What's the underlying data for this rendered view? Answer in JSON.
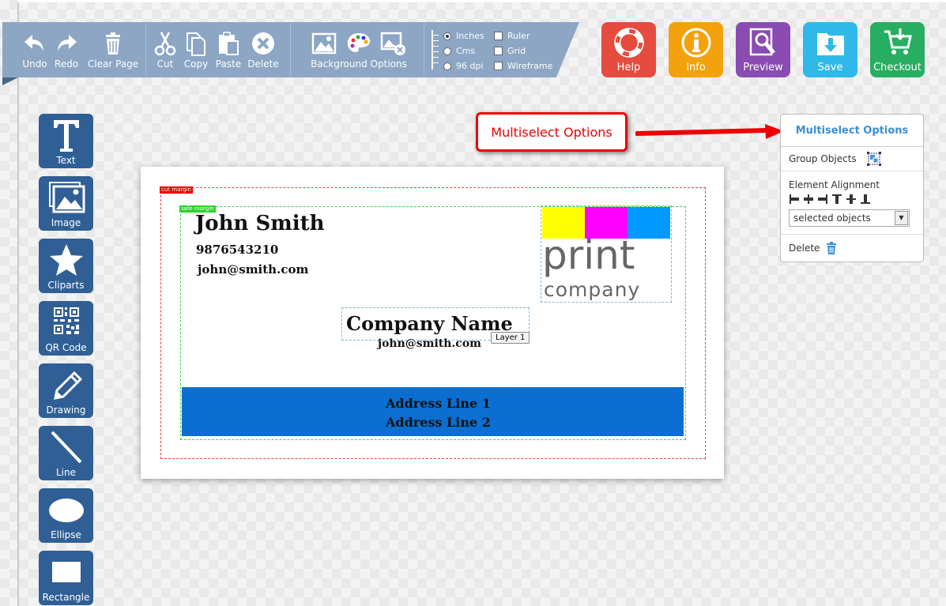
{
  "toolbar": {
    "undo": "Undo",
    "redo": "Redo",
    "clear_page": "Clear Page",
    "cut": "Cut",
    "copy": "Copy",
    "paste": "Paste",
    "delete": "Delete",
    "background_options": "Background Options",
    "units": [
      {
        "label": "Inches",
        "selected": true
      },
      {
        "label": "Cms",
        "selected": false
      },
      {
        "label": "96 dpi",
        "selected": false
      }
    ],
    "toggles": [
      {
        "label": "Ruler",
        "checked": false
      },
      {
        "label": "Grid",
        "checked": false
      },
      {
        "label": "Wireframe",
        "checked": false
      }
    ]
  },
  "actions": {
    "help": {
      "label": "Help",
      "color": "#e54b3e"
    },
    "info": {
      "label": "Info",
      "color": "#f4a20c"
    },
    "preview": {
      "label": "Preview",
      "color": "#8a4bb2"
    },
    "save": {
      "label": "Save",
      "color": "#2fb9e8"
    },
    "checkout": {
      "label": "Checkout",
      "color": "#27ae60"
    }
  },
  "tools": {
    "text": "Text",
    "image": "Image",
    "cliparts": "Cliparts",
    "qr_code": "QR Code",
    "drawing": "Drawing",
    "line": "Line",
    "ellipse": "Ellipse",
    "rectangle": "Rectangle"
  },
  "card": {
    "cut_margin": "cut margin",
    "safe_margin": "safe margin",
    "name": "John Smith",
    "phone": "9876543210",
    "email": "john@smith.com",
    "company": "Company Name",
    "company_email": "john@smith.com",
    "address1": "Address Line 1",
    "address2": "Address Line 2",
    "layer_tip": "Layer 1",
    "logo_word1": "print",
    "logo_word2": "company",
    "band_color": "#0b6fd1",
    "swatches": [
      "#ffff00",
      "#ff00ff",
      "#0099ff"
    ]
  },
  "callout": {
    "label": "Multiselect Options"
  },
  "panel": {
    "title": "Multiselect Options",
    "group_objects": "Group Objects",
    "element_alignment": "Element Alignment",
    "align_to": "selected objects",
    "delete": "Delete"
  }
}
